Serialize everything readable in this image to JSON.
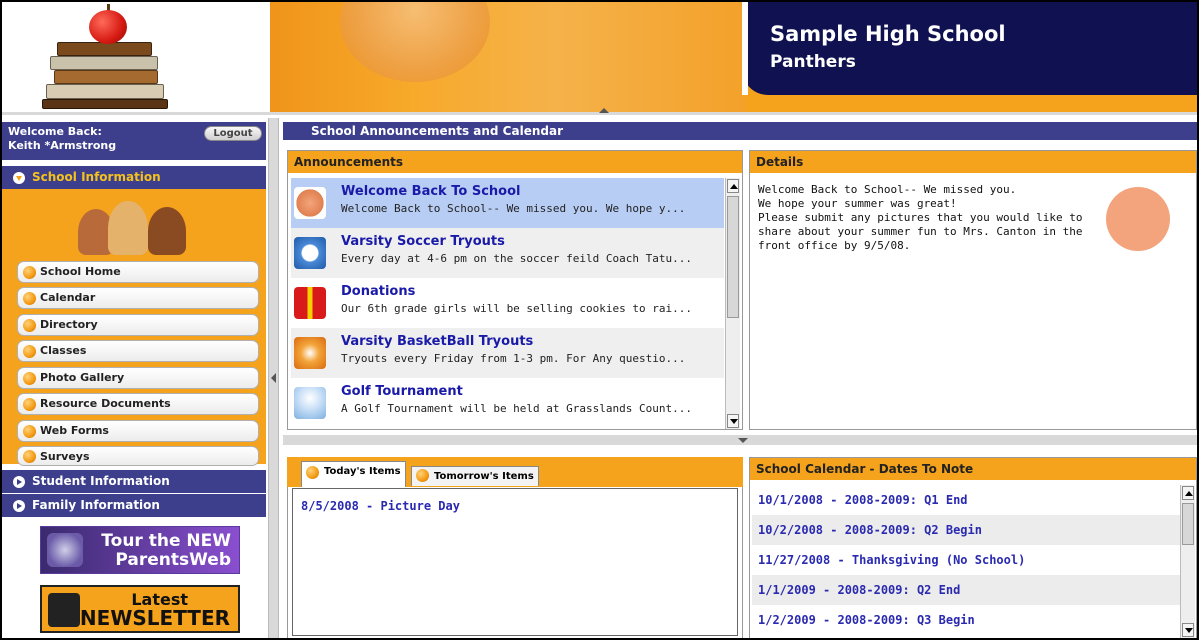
{
  "header": {
    "school_name": "Sample High School",
    "mascot": "Panthers"
  },
  "user": {
    "welcome_label": "Welcome Back:",
    "name": "Keith *Armstrong",
    "logout_label": "Logout"
  },
  "sidebar": {
    "school_information_label": "School Information",
    "items": [
      {
        "label": "School Home"
      },
      {
        "label": "Calendar"
      },
      {
        "label": "Directory"
      },
      {
        "label": "Classes"
      },
      {
        "label": "Photo Gallery"
      },
      {
        "label": "Resource Documents"
      },
      {
        "label": "Web Forms"
      },
      {
        "label": "Surveys"
      }
    ],
    "student_information_label": "Student Information",
    "family_information_label": "Family Information"
  },
  "promos": {
    "tour_line1": "Tour the NEW",
    "tour_line2": "ParentsWeb",
    "newsletter_line1": "Latest",
    "newsletter_line2": "NEWSLETTER"
  },
  "main": {
    "title": "School Announcements and Calendar"
  },
  "announcements": {
    "heading": "Announcements",
    "items": [
      {
        "title": "Welcome Back To School",
        "snippet": "Welcome Back to School-- We missed you. We hope y...",
        "icon": "confetti-icon"
      },
      {
        "title": "Varsity Soccer Tryouts",
        "snippet": "Every day at 4-6 pm on the soccer feild Coach Tatu...",
        "icon": "soccer-ball-icon"
      },
      {
        "title": "Donations",
        "snippet": "Our 6th grade girls will be selling cookies to rai...",
        "icon": "gift-icon"
      },
      {
        "title": "Varsity BasketBall Tryouts",
        "snippet": "Tryouts every Friday from 1-3 pm. For Any questio...",
        "icon": "basketball-icon"
      },
      {
        "title": "Golf Tournament",
        "snippet": "A Golf Tournament will be held at Grasslands Count...",
        "icon": "golf-ball-icon"
      }
    ]
  },
  "details": {
    "heading": "Details",
    "line1": "Welcome Back to School-- We missed you.",
    "line2": "We hope your summer was great!",
    "line3": "Please submit any pictures that you would like to",
    "line4": "share about your summer fun to Mrs. Canton in the",
    "line5": "front office by 9/5/08."
  },
  "items_tabs": {
    "today_label": "Today's Items",
    "tomorrow_label": "Tomorrow's Items",
    "today_items": [
      "8/5/2008 - Picture Day"
    ]
  },
  "calendar": {
    "heading": "School Calendar - Dates To Note",
    "dates": [
      "10/1/2008 - 2008-2009: Q1 End",
      "10/2/2008 - 2008-2009: Q2 Begin",
      "11/27/2008 - Thanksgiving (No School)",
      "1/1/2009 - 2008-2009: Q2 End",
      "1/2/2009 - 2008-2009: Q3 Begin"
    ]
  },
  "colors": {
    "nav_blue": "#3d3f8d",
    "orange": "#f5a21c",
    "title_navy": "#0f1150",
    "link_blue": "#1a1aa8"
  }
}
